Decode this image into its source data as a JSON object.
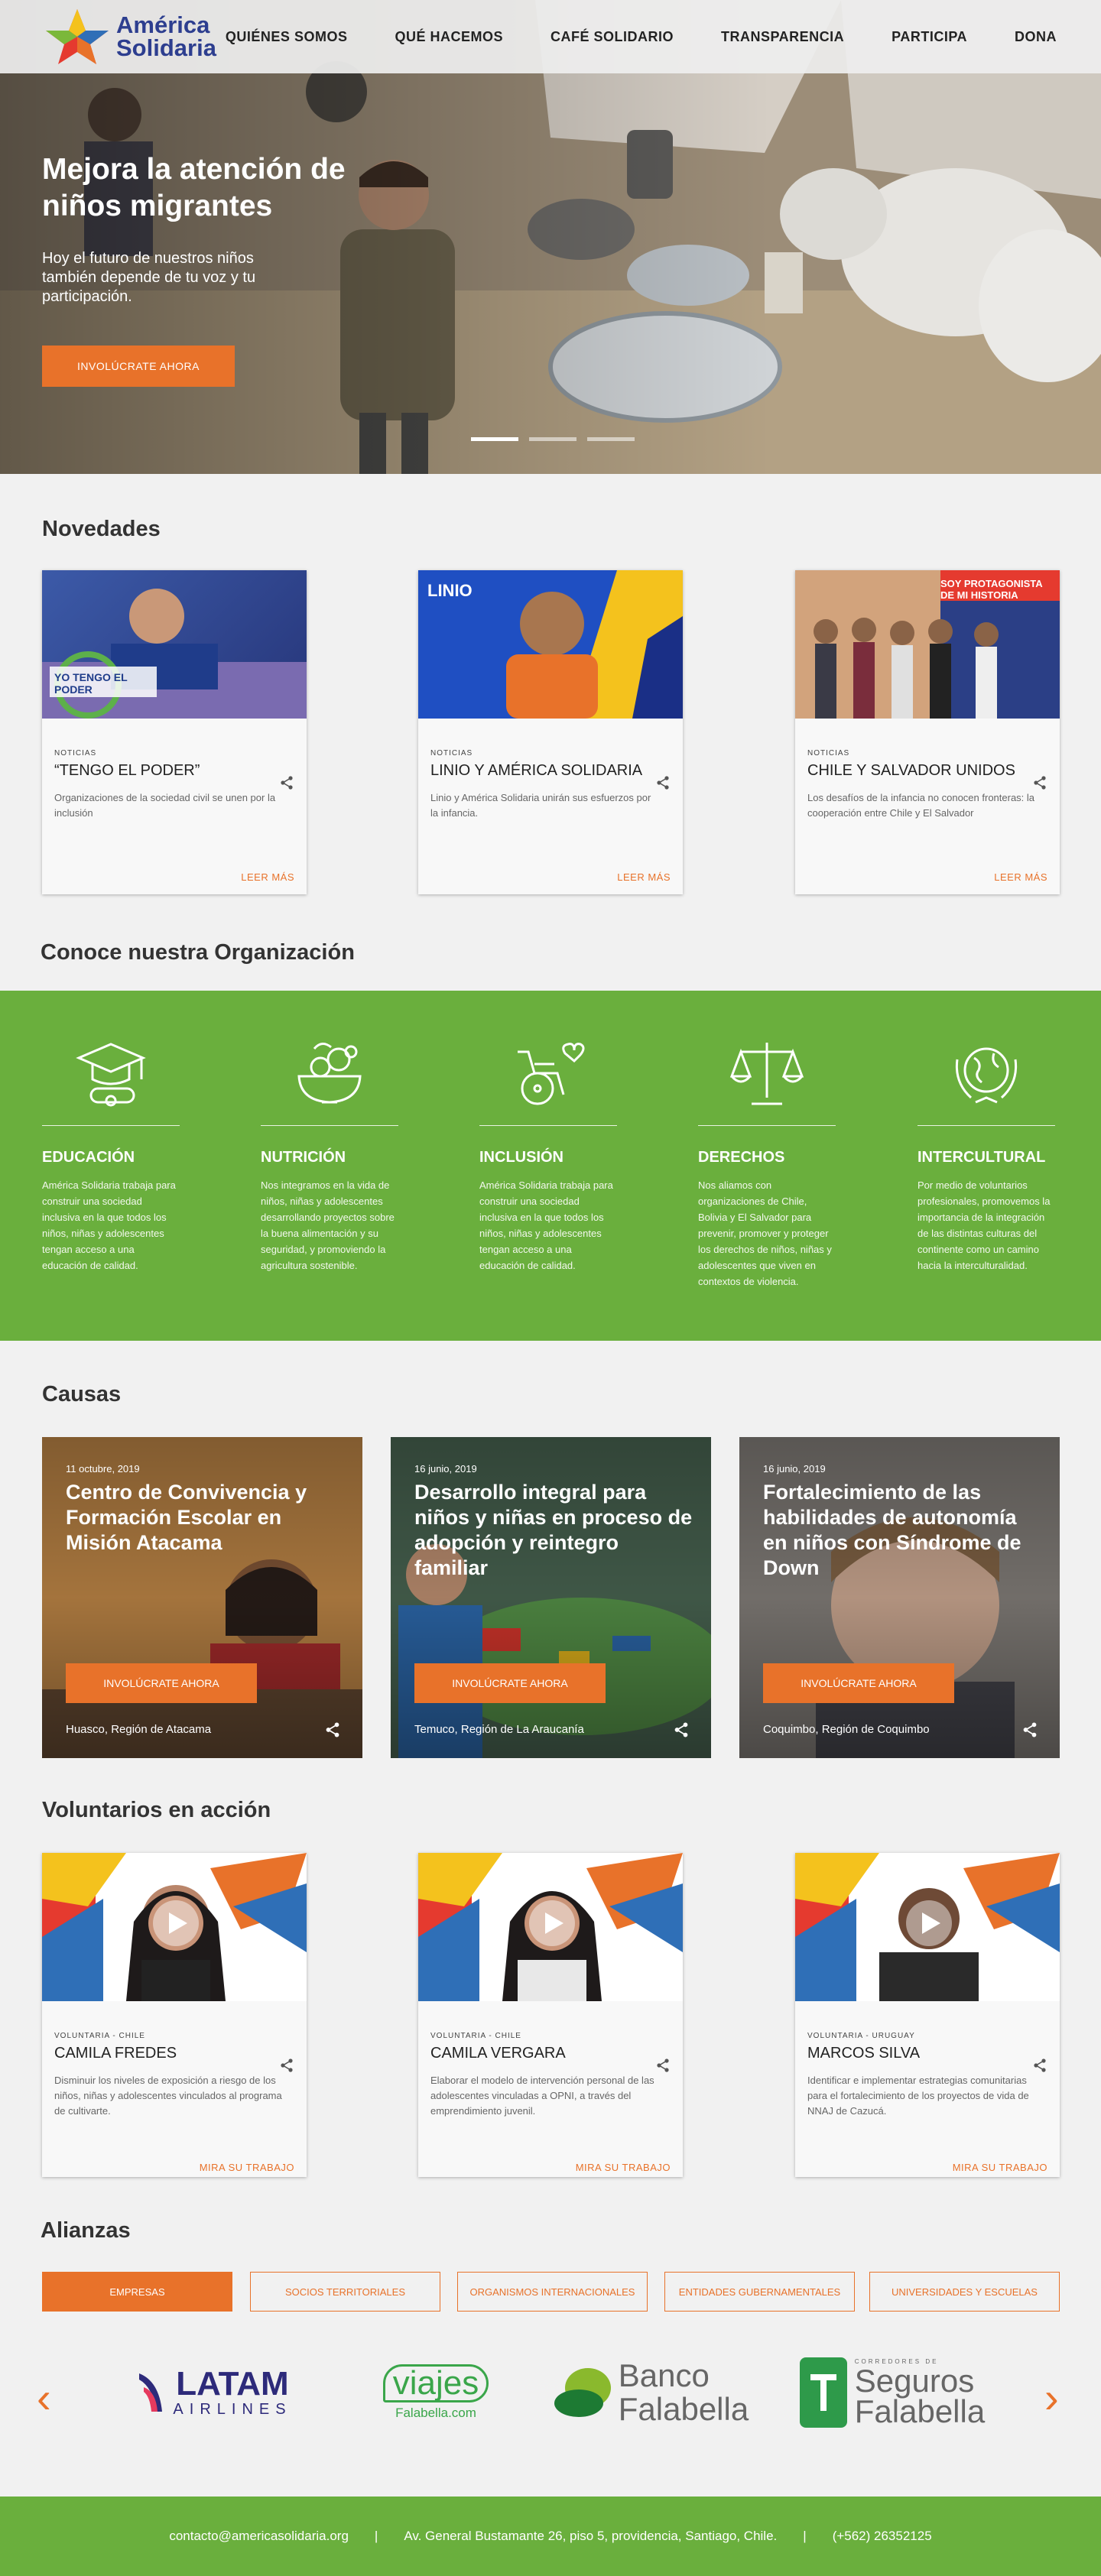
{
  "colors": {
    "accent": "#e8722a",
    "green": "#6aaf3d",
    "navy": "#2d3e8f"
  },
  "brand": {
    "line1": "América",
    "line2": "Solidaria"
  },
  "nav": [
    {
      "label": "QUIÉNES SOMOS"
    },
    {
      "label": "QUÉ HACEMOS"
    },
    {
      "label": "CAFÉ SOLIDARIO"
    },
    {
      "label": "TRANSPARENCIA"
    },
    {
      "label": "PARTICIPA"
    },
    {
      "label": "DONA"
    }
  ],
  "hero": {
    "title": "Mejora la atención de niños migrantes",
    "subtitle": "Hoy el futuro de nuestros niños también depende de tu voz y tu participación.",
    "button": "INVOLÚCRATE AHORA",
    "slides": 3,
    "active_slide": 1
  },
  "news": {
    "title": "Novedades",
    "items": [
      {
        "category": "NOTICIAS",
        "title": "“TENGO EL PODER”",
        "text": "Organizaciones de la sociedad civil se unen por la inclusión",
        "more": "LEER MÁS",
        "image_label": "YO TENGO EL PODER"
      },
      {
        "category": "NOTICIAS",
        "title": "LINIO Y AMÉRICA SOLIDARIA",
        "text": "Linio y América Solidaria unirán sus esfuerzos por la infancia.",
        "more": "LEER MÁS",
        "image_label": "LINIO"
      },
      {
        "category": "NOTICIAS",
        "title": "CHILE Y SALVADOR UNIDOS",
        "text": " Los desafíos de la infancia no conocen fronteras: la cooperación entre Chile y El Salvador",
        "more": "LEER MÁS",
        "image_label": "SOY PROTAGONISTA DE MI HISTORIA"
      }
    ]
  },
  "org": {
    "title": "Conoce nuestra Organización",
    "columns": [
      {
        "icon": "graduation-cap-icon",
        "title": "EDUCACIÓN",
        "text": "América Solidaria trabaja para construir una sociedad inclusiva en la que todos los niños, niñas y adolescentes tengan acceso a una educación de calidad."
      },
      {
        "icon": "food-bowl-icon",
        "title": "NUTRICIÓN",
        "text": "Nos integramos en la vida de niños, niñas y adolescentes desarrollando proyectos sobre la buena alimentación y su seguridad, y promoviendo la agricultura sostenible."
      },
      {
        "icon": "wheelchair-heart-icon",
        "title": "INCLUSIÓN",
        "text": "América Solidaria trabaja para construir una sociedad inclusiva en la que todos los niños, niñas y adolescentes tengan acceso a una educación de calidad."
      },
      {
        "icon": "scales-icon",
        "title": "DERECHOS",
        "text": "Nos aliamos con organizaciones de Chile, Bolivia y El Salvador para prevenir, promover y proteger los derechos de niños, niñas y adolescentes que viven en contextos de violencia."
      },
      {
        "icon": "globe-laurel-icon",
        "title": "INTERCULTURAL",
        "text": "Por medio de voluntarios profesionales, promovemos la importancia de la integración de las distintas culturas del continente como un camino hacia la interculturalidad."
      }
    ]
  },
  "causes": {
    "title": "Causas",
    "items": [
      {
        "date": "11 octubre, 2019",
        "title": "Centro de Convivencia y Formación Escolar en Misión Atacama",
        "button": "INVOLÚCRATE AHORA",
        "location": "Huasco, Región de Atacama"
      },
      {
        "date": "16 junio, 2019",
        "title": "Desarrollo integral para niños y niñas en proceso de adopción y reintegro familiar",
        "button": "INVOLÚCRATE AHORA",
        "location": "Temuco, Región de La Araucanía"
      },
      {
        "date": "16 junio, 2019",
        "title": "Fortalecimiento de las habilidades de autonomía en niños con Síndrome de Down",
        "button": "INVOLÚCRATE AHORA",
        "location": "Coquimbo, Región de Coquimbo"
      }
    ]
  },
  "volunteers": {
    "title": "Voluntarios en acción",
    "items": [
      {
        "category": "VOLUNTARIA - CHILE",
        "name": "CAMILA FREDES",
        "text": "Disminuir los niveles de exposición a riesgo de los niños, niñas y adolescentes vinculados al programa de cultivarte.",
        "more": "MIRA SU TRABAJO"
      },
      {
        "category": "VOLUNTARIA - CHILE",
        "name": "CAMILA VERGARA",
        "text": "Elaborar el modelo de intervención personal de las adolescentes vinculadas a OPNI, a través del emprendimiento juvenil.",
        "more": "MIRA SU TRABAJO"
      },
      {
        "category": "VOLUNTARIA - URUGUAY",
        "name": "MARCOS SILVA",
        "text": "Identificar e implementar estrategias comunitarias para el fortalecimiento de los proyectos de vida de NNAJ de Cazucá.",
        "more": "MIRA SU TRABAJO"
      }
    ]
  },
  "alliances": {
    "title": "Alianzas",
    "tabs": [
      {
        "label": "EMPRESAS"
      },
      {
        "label": "SOCIOS TERRITORIALES"
      },
      {
        "label": "ORGANISMOS INTERNACIONALES"
      },
      {
        "label": "ENTIDADES GUBERNAMENTALES"
      },
      {
        "label": "UNIVERSIDADES Y ESCUELAS"
      }
    ],
    "active_tab": 0,
    "prev": "‹",
    "next": "›",
    "brands": {
      "latam1": "LATAM",
      "latam2": "AIRLINES",
      "viajes1": "viajes",
      "viajes2": "Falabella.com",
      "banco1": "Banco",
      "banco2": "Falabella",
      "seguros0": "CORREDORES DE",
      "seguros1": "Seguros",
      "seguros2": "Falabella"
    }
  },
  "footer": {
    "email": "contacto@americasolidaria.org",
    "address": "Av. General Bustamante 26, piso 5, providencia, Santiago, Chile.",
    "phone": "(+562) 26352125",
    "separator": "|"
  }
}
